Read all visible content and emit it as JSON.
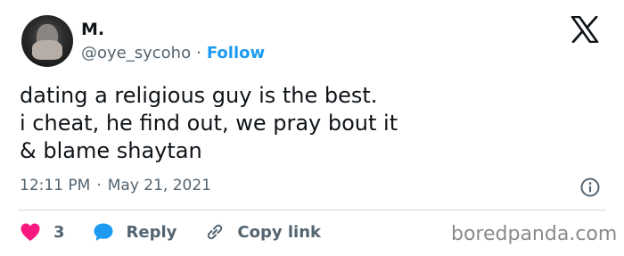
{
  "author": {
    "name": "M.",
    "handle": "@oye_sycoho",
    "separator": "·",
    "follow_label": "Follow"
  },
  "tweet": {
    "text": "dating a religious guy is the best.\ni cheat, he find out, we pray bout it\n& blame shaytan",
    "time": "12:11 PM",
    "separator": "·",
    "date": "May 21, 2021"
  },
  "actions": {
    "like_count": "3",
    "reply_label": "Reply",
    "copy_link_label": "Copy link"
  },
  "watermark": "boredpanda.com",
  "colors": {
    "accent": "#1d9bf0",
    "like": "#f91880",
    "text": "#0f1419",
    "muted": "#536471"
  },
  "icons": [
    "x-logo-icon",
    "info-icon",
    "heart-icon",
    "reply-bubble-icon",
    "link-icon"
  ]
}
